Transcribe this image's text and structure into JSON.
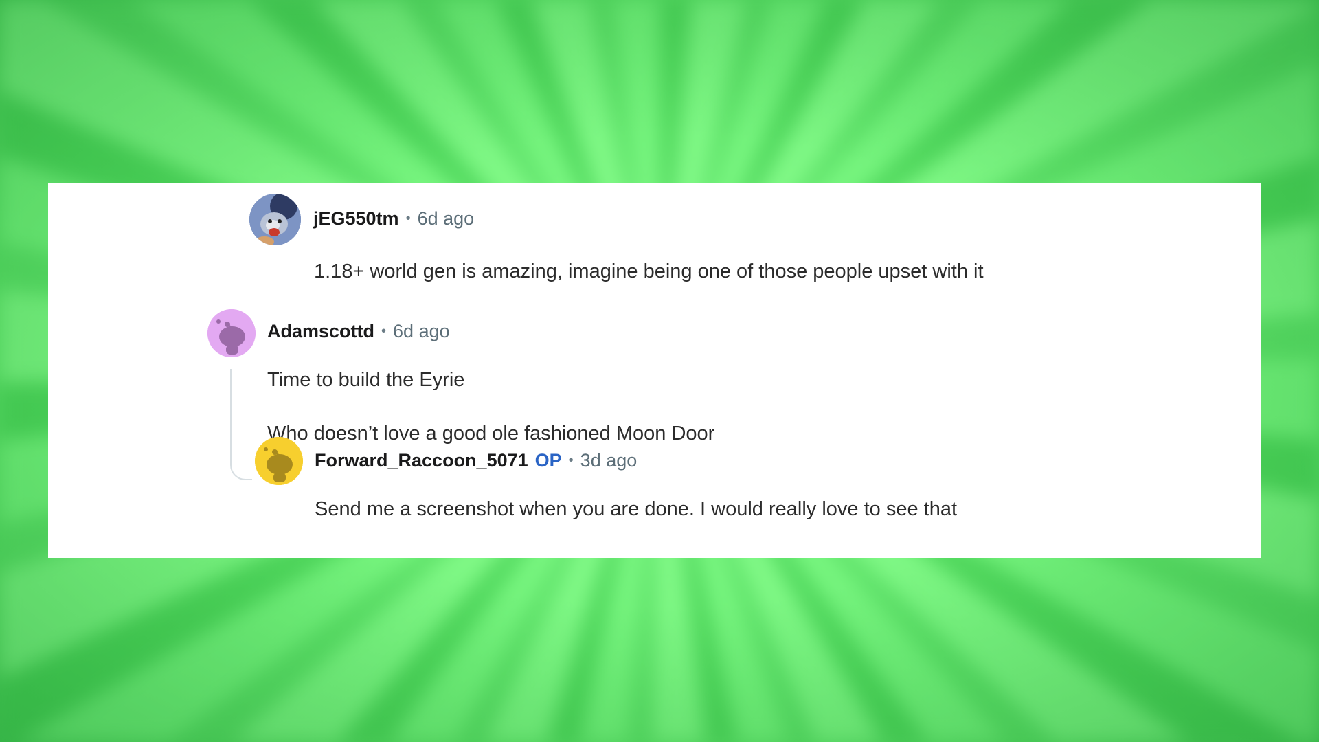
{
  "comments": [
    {
      "author": "jEG550tm",
      "separator": "•",
      "time": "6d ago",
      "body": "1.18+ world gen is amazing, imagine being one of those people upset with it"
    },
    {
      "author": "Adamscottd",
      "separator": "•",
      "time": "6d ago",
      "body_lines": [
        "Time to build the Eyrie",
        "Who doesn’t love a good ole fashioned Moon Door"
      ]
    },
    {
      "author": "Forward_Raccoon_5071",
      "badge": "OP",
      "separator": "•",
      "time": "3d ago",
      "body": "Send me a screenshot when you are done. I would really love to see that"
    }
  ],
  "colors": {
    "op_badge": "#2a64c5",
    "avatar_purple": "#e3a9f2",
    "avatar_yellow": "#f7cf2e",
    "background_green": "#7cf883"
  },
  "icons": [
    "user-avatar-photo",
    "snoo-avatar-purple",
    "snoo-avatar-yellow"
  ]
}
